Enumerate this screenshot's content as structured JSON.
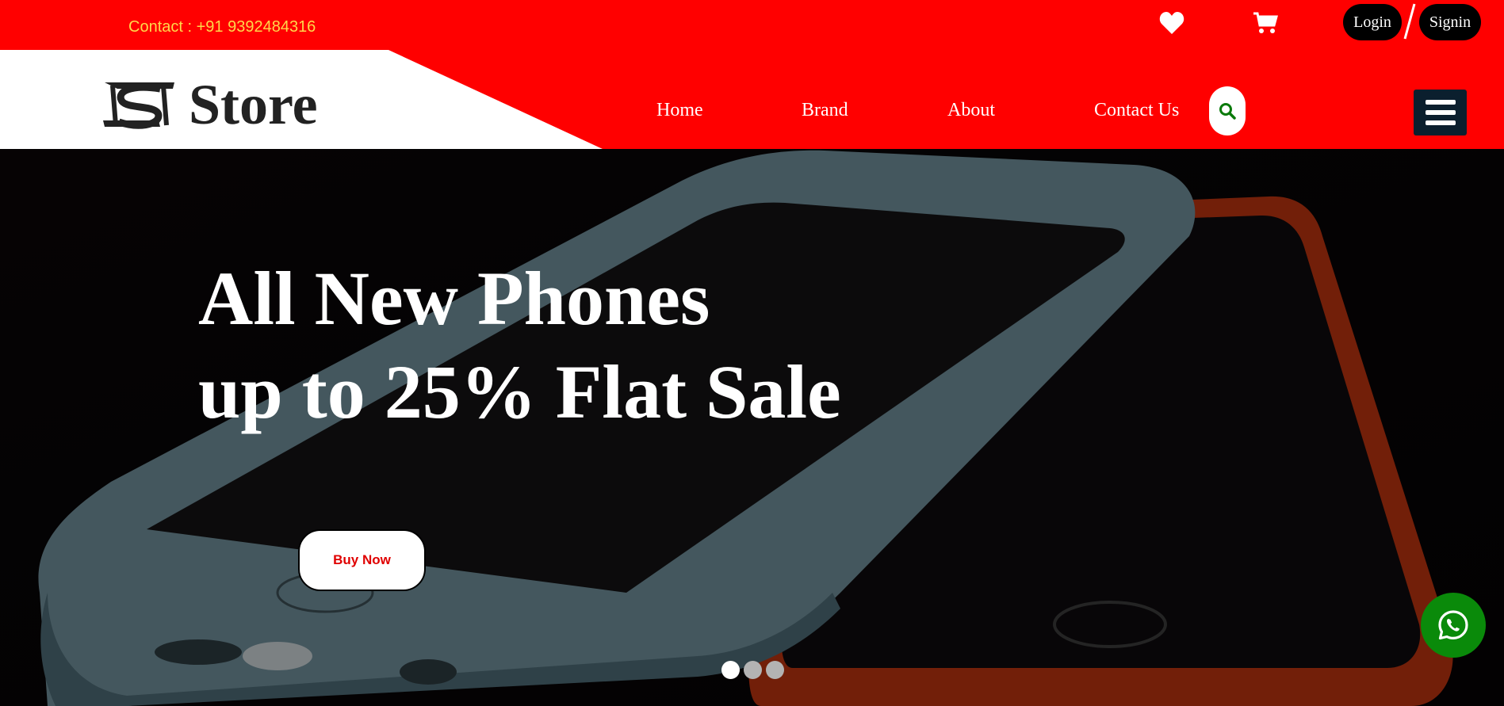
{
  "header": {
    "contact_text": "Contact : +91 9392484316",
    "brand_name": "Store",
    "auth": {
      "login_label": "Login",
      "signin_label": "Signin"
    },
    "nav": [
      {
        "label": "Home"
      },
      {
        "label": "Brand"
      },
      {
        "label": "About"
      },
      {
        "label": "Contact Us"
      }
    ],
    "icons": {
      "heart": "heart-icon",
      "cart": "cart-icon",
      "search": "search-icon",
      "menu": "hamburger-menu-icon"
    }
  },
  "hero": {
    "title_line1": "All New Phones",
    "title_line2": "up to 25% Flat Sale",
    "cta_label": "Buy Now",
    "slides": 3,
    "active_slide": 1
  },
  "floating": {
    "whatsapp": "whatsapp-icon"
  },
  "colors": {
    "header_bg": "#ff0000",
    "contact_text": "#ffd84a",
    "cta_text": "#e00000",
    "search_icon": "#0a7a0a",
    "menu_bg": "#0b1f2e",
    "whatsapp_bg": "#0a8a0a",
    "hero_bg": "#060406"
  }
}
